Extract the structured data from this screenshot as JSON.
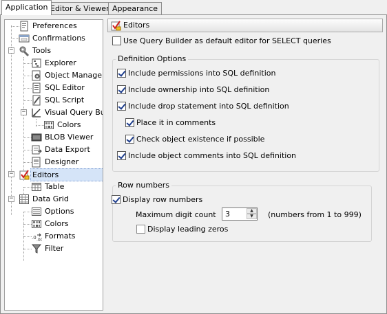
{
  "tabs": [
    {
      "label": "Application",
      "accel": "A"
    },
    {
      "label": "Editor & Viewers",
      "accel": "E"
    },
    {
      "label": "Appearance",
      "accel": "p"
    }
  ],
  "tree": [
    {
      "label": "Preferences",
      "icon": "preferences-icon"
    },
    {
      "label": "Confirmations",
      "icon": "confirmations-icon"
    },
    {
      "label": "Tools",
      "icon": "tools-icon"
    },
    {
      "label": "Explorer",
      "icon": "explorer-icon"
    },
    {
      "label": "Object Manager",
      "icon": "object-manager-icon"
    },
    {
      "label": "SQL Editor",
      "icon": "sql-editor-icon"
    },
    {
      "label": "SQL Script",
      "icon": "sql-script-icon"
    },
    {
      "label": "Visual Query Builder",
      "icon": "visual-query-builder-icon"
    },
    {
      "label": "Colors",
      "icon": "colors-icon"
    },
    {
      "label": "BLOB Viewer",
      "icon": "blob-viewer-icon"
    },
    {
      "label": "Data Export",
      "icon": "data-export-icon"
    },
    {
      "label": "Designer",
      "icon": "designer-icon"
    },
    {
      "label": "Editors",
      "icon": "editors-icon"
    },
    {
      "label": "Table",
      "icon": "table-icon"
    },
    {
      "label": "Data Grid",
      "icon": "data-grid-icon"
    },
    {
      "label": "Options",
      "icon": "options-icon"
    },
    {
      "label": "Colors",
      "icon": "colors-icon"
    },
    {
      "label": "Formats",
      "icon": "formats-icon"
    },
    {
      "label": "Filter",
      "icon": "filter-icon"
    }
  ],
  "section_title": "Editors",
  "use_query_builder": {
    "label": "Use Query Builder as default editor for SELECT queries",
    "checked": false
  },
  "definition_options": {
    "title": "Definition Options",
    "items": [
      {
        "label": "Include permissions into SQL definition",
        "checked": true
      },
      {
        "label": "Include ownership into SQL definition",
        "checked": true
      },
      {
        "label": "Include drop statement into SQL definition",
        "checked": true
      },
      {
        "label": "Place it in comments",
        "checked": true
      },
      {
        "label": "Check object existence if possible",
        "checked": true
      },
      {
        "label": "Include object comments into SQL definition",
        "checked": true
      }
    ]
  },
  "row_numbers": {
    "title": "Row numbers",
    "display_label": "Display row numbers",
    "display_checked": true,
    "max_digit_label": "Maximum digit count",
    "max_digit_value": "3",
    "range_note": "(numbers from 1 to 999)",
    "leading_zeros_label": "Display leading zeros",
    "leading_zeros_checked": false
  }
}
